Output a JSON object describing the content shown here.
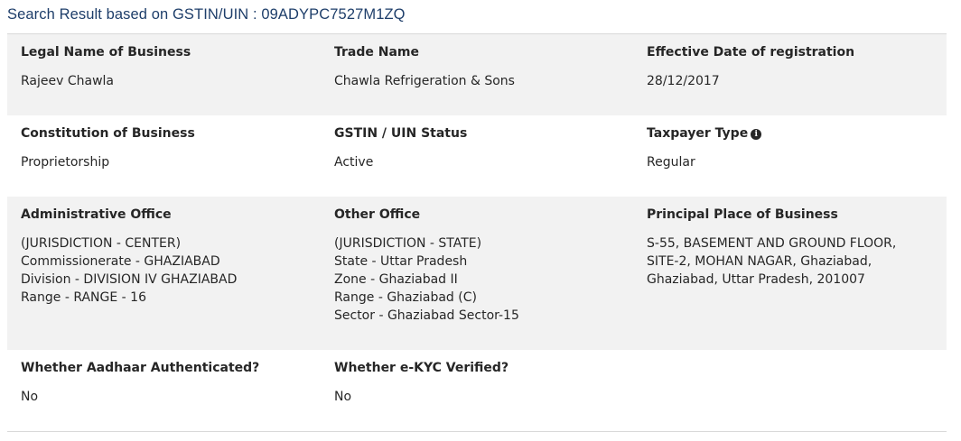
{
  "heading": "Search Result based on GSTIN/UIN : 09ADYPC7527M1ZQ",
  "row1": {
    "legal_name": {
      "label": "Legal Name of Business",
      "value": "Rajeev Chawla"
    },
    "trade_name": {
      "label": "Trade Name",
      "value": "Chawla Refrigeration & Sons"
    },
    "effective_date": {
      "label": "Effective Date of registration",
      "value": "28/12/2017"
    }
  },
  "row2": {
    "constitution": {
      "label": "Constitution of Business",
      "value": "Proprietorship"
    },
    "status": {
      "label": "GSTIN / UIN Status",
      "value": "Active"
    },
    "taxpayer_type": {
      "label": "Taxpayer Type",
      "value": "Regular",
      "icon": "info-circle-icon"
    }
  },
  "row3": {
    "admin_office": {
      "label": "Administrative Office",
      "lines": [
        "(JURISDICTION - CENTER)",
        "Commissionerate - GHAZIABAD",
        "Division - DIVISION IV GHAZIABAD",
        "Range - RANGE - 16"
      ]
    },
    "other_office": {
      "label": "Other Office",
      "lines": [
        "(JURISDICTION - STATE)",
        "State - Uttar Pradesh",
        "Zone - Ghaziabad II",
        "Range - Ghaziabad (C)",
        "Sector - Ghaziabad Sector-15"
      ]
    },
    "principal_place": {
      "label": "Principal Place of Business",
      "lines": [
        "S-55, BASEMENT AND GROUND FLOOR,",
        "SITE-2, MOHAN NAGAR, Ghaziabad,",
        "Ghaziabad, Uttar Pradesh, 201007"
      ]
    }
  },
  "row4": {
    "aadhaar": {
      "label": "Whether Aadhaar Authenticated?",
      "value": "No"
    },
    "ekyc": {
      "label": "Whether e-KYC Verified?",
      "value": "No"
    }
  },
  "colors": {
    "heading": "#1e3e6a",
    "shaded_row": "#f2f2f2",
    "divider": "#d9d9d9"
  }
}
